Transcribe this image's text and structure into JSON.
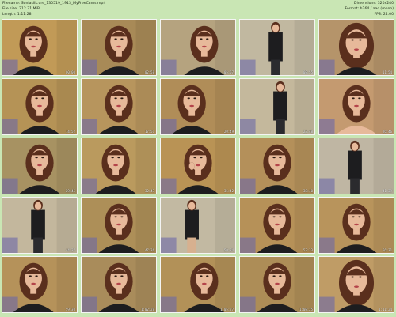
{
  "header": {
    "filename": "Filename: Soniasilk.ure_130519_1913_MyFreeCams.mp4",
    "filesize": "File size: 212.71 MiB",
    "length": "Length: 1:11:28",
    "dimensions": "Dimensions: 320x240",
    "format": "Format: h264 / aac (mono)",
    "fps": "FPS: 24.00"
  },
  "thumbnails": [
    {
      "time": "00:00",
      "pose": "face-left",
      "bg": "#c19a57"
    },
    {
      "time": "02:58",
      "pose": "face",
      "bg": "#a88a57"
    },
    {
      "time": "05:57",
      "pose": "face-right",
      "bg": "#b5a37f"
    },
    {
      "time": "08:55",
      "pose": "standing",
      "bg": "#c1b8a0"
    },
    {
      "time": "11:54",
      "pose": "face-close",
      "bg": "#b5946a"
    },
    {
      "time": "14:52",
      "pose": "face",
      "bg": "#b59356"
    },
    {
      "time": "17:51",
      "pose": "face",
      "bg": "#b7955d"
    },
    {
      "time": "20:49",
      "pose": "face-left",
      "bg": "#b08d58"
    },
    {
      "time": "23:48",
      "pose": "leaning",
      "bg": "#c4b89c"
    },
    {
      "time": "26:46",
      "pose": "topless",
      "bg": "#c49a70"
    },
    {
      "time": "29:45",
      "pose": "seated",
      "bg": "#a79262"
    },
    {
      "time": "32:43",
      "pose": "tilt",
      "bg": "#ba9a5e"
    },
    {
      "time": "35:42",
      "pose": "hand-face",
      "bg": "#b99355"
    },
    {
      "time": "38:40",
      "pose": "face",
      "bg": "#b4905a"
    },
    {
      "time": "41:39",
      "pose": "kneel",
      "bg": "#bfb6a3"
    },
    {
      "time": "44:37",
      "pose": "standing",
      "bg": "#c3b79d"
    },
    {
      "time": "47:36",
      "pose": "face",
      "bg": "#ad8f58"
    },
    {
      "time": "50:34",
      "pose": "back",
      "bg": "#c2b9a2"
    },
    {
      "time": "53:33",
      "pose": "face",
      "bg": "#b69158"
    },
    {
      "time": "56:31",
      "pose": "face",
      "bg": "#b8945c"
    },
    {
      "time": "59:30",
      "pose": "face-left",
      "bg": "#b5925a"
    },
    {
      "time": "1:02:28",
      "pose": "face",
      "bg": "#a98c5b"
    },
    {
      "time": "1:05:27",
      "pose": "face-right",
      "bg": "#b29158"
    },
    {
      "time": "1:08:25",
      "pose": "face",
      "bg": "#ad8d57"
    },
    {
      "time": "1:11:24",
      "pose": "face-close",
      "bg": "#bf9c66"
    }
  ]
}
